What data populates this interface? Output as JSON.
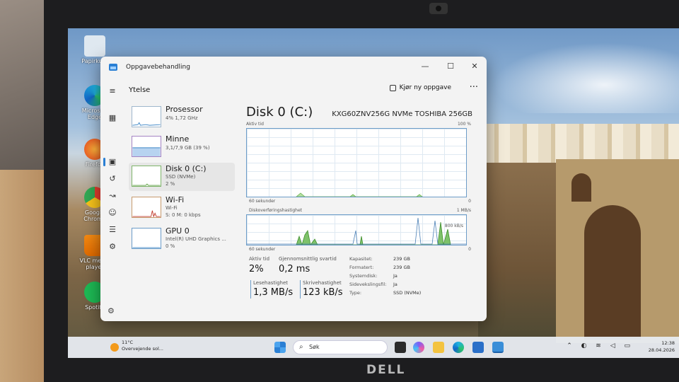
{
  "window": {
    "title": "Oppgavebehandling",
    "minimize": "—",
    "maximize": "☐",
    "close": "✕"
  },
  "header": {
    "title": "Ytelse",
    "new_task": "Kjør ny oppgave",
    "more": "···"
  },
  "sidebar": {
    "items": [
      {
        "name": "Prosessor",
        "sub": "4% 1,72 GHz",
        "sub2": ""
      },
      {
        "name": "Minne",
        "sub": "3,1/7,9 GB (39 %)",
        "sub2": ""
      },
      {
        "name": "Disk 0 (C:)",
        "sub": "SSD (NVMe)",
        "sub2": "2 %"
      },
      {
        "name": "Wi-Fi",
        "sub": "Wi-Fi",
        "sub2": "S: 0 M: 0 kbps"
      },
      {
        "name": "GPU 0",
        "sub": "Intel(R) UHD Graphics ...",
        "sub2": "0 %"
      }
    ]
  },
  "disk": {
    "title": "Disk 0 (C:)",
    "model": "KXG60ZNV256G NVMe TOSHIBA 256GB",
    "graph1": {
      "label": "Aktiv tid",
      "max": "100 %",
      "time": "60 sekunder",
      "min": "0"
    },
    "graph2": {
      "label": "Diskoverføringshastighet",
      "max": "1 MB/s",
      "mid": "800 kB/s",
      "time": "60 sekunder",
      "min": "0"
    },
    "stats": {
      "active_label": "Aktiv tid",
      "active_value": "2%",
      "resp_label": "Gjennomsnittlig svartid",
      "resp_value": "0,2 ms",
      "read_label": "Lesehastighet",
      "read_value": "1,3 MB/s",
      "write_label": "Skrivehastighet",
      "write_value": "123 kB/s"
    },
    "props": [
      {
        "k": "Kapasitet:",
        "v": "239 GB"
      },
      {
        "k": "Formatert:",
        "v": "239 GB"
      },
      {
        "k": "Systemdisk:",
        "v": "Ja"
      },
      {
        "k": "Sidevekslingsfil:",
        "v": "Ja"
      },
      {
        "k": "Type:",
        "v": "SSD (NVMe)"
      }
    ]
  },
  "desktop": {
    "icons": [
      "Papirkurv",
      "Microsoft Edge",
      "Firefox",
      "Google Chrome",
      "VLC media player",
      "Spotify"
    ]
  },
  "taskbar": {
    "weather_temp": "11°C",
    "weather_desc": "Overvejende sol...",
    "search_placeholder": "Søk",
    "time": "12:38",
    "date": "28.04.2026"
  },
  "brand": "DELL",
  "colors": {
    "accent": "#2a7fd4",
    "graph_fill": "#7ec26a"
  }
}
